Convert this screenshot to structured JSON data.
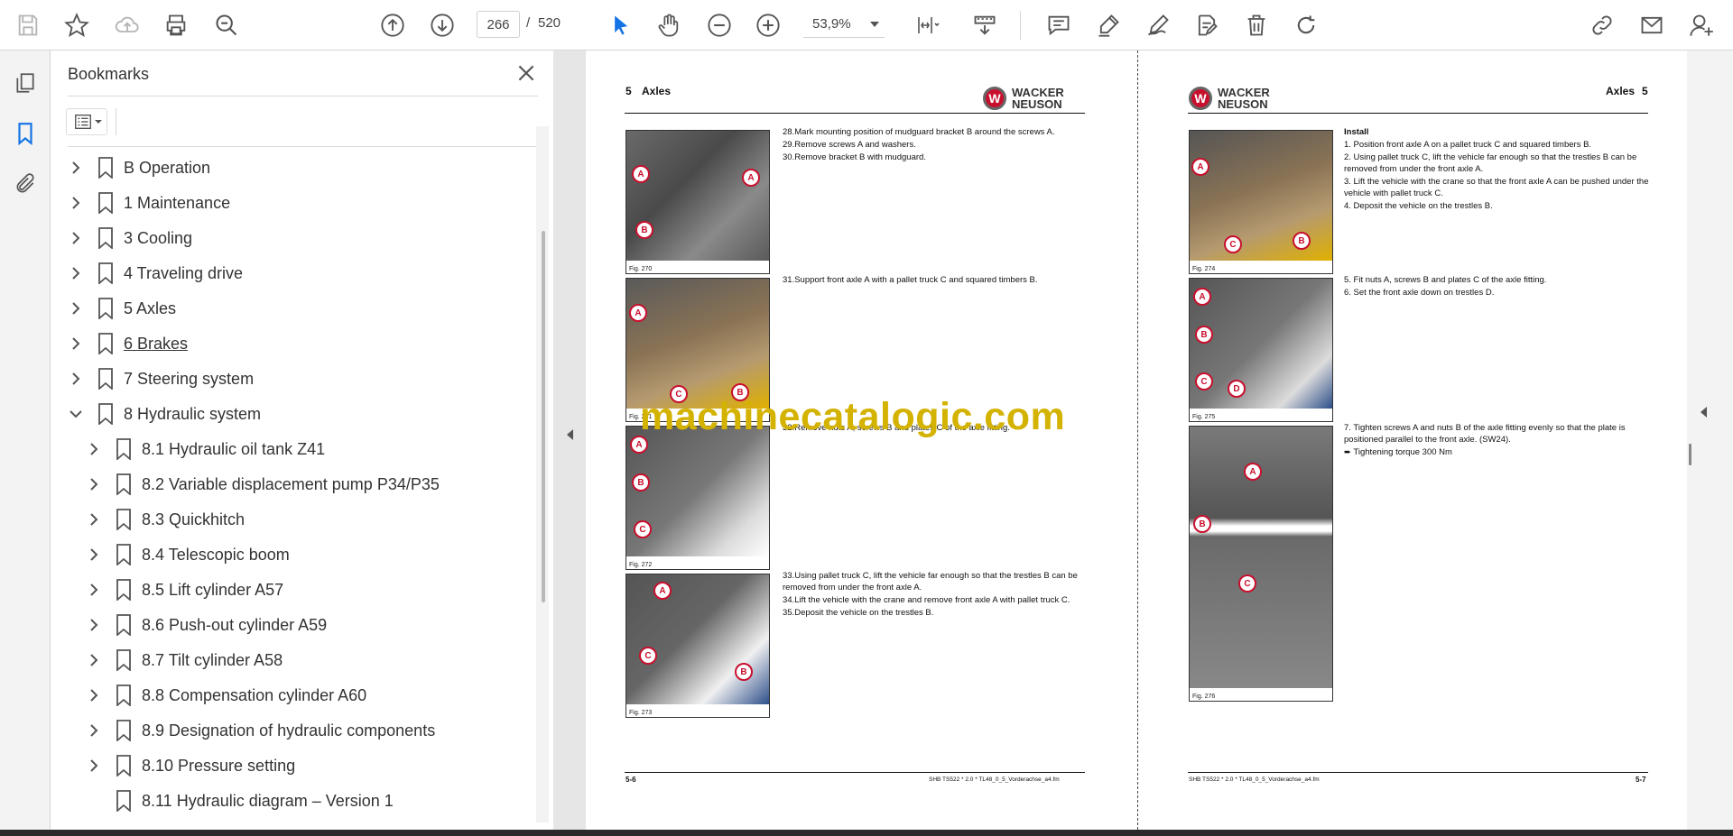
{
  "toolbar": {
    "current_page": "266",
    "page_separator": "/",
    "total_pages": "520",
    "zoom": "53,9%"
  },
  "bookmarks": {
    "title": "Bookmarks",
    "items": [
      {
        "label": "B Operation",
        "level": 0,
        "expanded": false
      },
      {
        "label": "1 Maintenance",
        "level": 0,
        "expanded": false
      },
      {
        "label": "3 Cooling",
        "level": 0,
        "expanded": false
      },
      {
        "label": "4 Traveling drive",
        "level": 0,
        "expanded": false
      },
      {
        "label": "5 Axles",
        "level": 0,
        "expanded": false
      },
      {
        "label": "6 Brakes",
        "level": 0,
        "expanded": false,
        "underlined": true
      },
      {
        "label": "7 Steering system",
        "level": 0,
        "expanded": false
      },
      {
        "label": "8 Hydraulic system",
        "level": 0,
        "expanded": true
      },
      {
        "label": "8.1 Hydraulic oil tank Z41",
        "level": 1,
        "expanded": false
      },
      {
        "label": "8.2 Variable displacement pump P34/P35",
        "level": 1,
        "expanded": false
      },
      {
        "label": "8.3 Quickhitch",
        "level": 1,
        "expanded": false
      },
      {
        "label": "8.4 Telescopic boom",
        "level": 1,
        "expanded": false
      },
      {
        "label": "8.5 Lift cylinder A57",
        "level": 1,
        "expanded": false
      },
      {
        "label": "8.6 Push-out cylinder A59",
        "level": 1,
        "expanded": false
      },
      {
        "label": "8.7 Tilt cylinder A58",
        "level": 1,
        "expanded": false
      },
      {
        "label": "8.8 Compensation cylinder A60",
        "level": 1,
        "expanded": false
      },
      {
        "label": "8.9 Designation of hydraulic components",
        "level": 1,
        "expanded": false
      },
      {
        "label": "8.10 Pressure setting",
        "level": 1,
        "expanded": false
      },
      {
        "label": "8.11 Hydraulic diagram – Version 1",
        "level": 1,
        "leaf": true
      }
    ]
  },
  "left_page": {
    "header_num": "5",
    "header_title": "Axles",
    "brand_line1": "WACKER",
    "brand_line2": "NEUSON",
    "steps_a": [
      "28.Mark mounting position of mudguard bracket B around the screws A.",
      "29.Remove screws A and washers.",
      "30.Remove bracket B with mudguard."
    ],
    "steps_b": [
      "31.Support front axle A with a pallet truck C and squared timbers B."
    ],
    "steps_c": [
      "32.Remove nuts A, screws B and plates C of the axle fitting."
    ],
    "steps_d": [
      "33.Using pallet truck C, lift the vehicle far enough so that the trestles B can be removed from under the front axle A.",
      "34.Lift the vehicle with the crane and remove front axle A with pallet truck C.",
      "35.Deposit the vehicle on the trestles B."
    ],
    "fig_270": "Fig. 270",
    "fig_271": "Fig. 271",
    "fig_272": "Fig. 272",
    "fig_273": "Fig. 273",
    "footer_page": "5-6",
    "footer_doc": "SHB TS522 * 2.0 * TL48_0_5_Vorderachse_a4.fm"
  },
  "right_page": {
    "header_title": "Axles",
    "header_num": "5",
    "brand_line1": "WACKER",
    "brand_line2": "NEUSON",
    "install_title": "Install",
    "steps_a": [
      "1.  Position front axle A on a pallet truck C and squared timbers B.",
      "2.  Using pallet truck C, lift the vehicle far enough so that the trestles B can be removed from under the front axle A.",
      "3.  Lift the vehicle with the crane so that the front axle A can be pushed under the vehicle with pallet truck C.",
      "4.  Deposit the vehicle on the trestles B."
    ],
    "steps_b": [
      "5.  Fit nuts A, screws B and plates C of the axle fitting.",
      "6.  Set the front axle down on trestles D."
    ],
    "steps_c": [
      "7.  Tighten screws A and nuts B of the axle fitting evenly so that the plate is positioned parallel to the front axle. (SW24).",
      "➨  Tightening torque 300 Nm"
    ],
    "fig_274": "Fig. 274",
    "fig_275": "Fig. 275",
    "fig_276": "Fig. 276",
    "footer_page": "5-7",
    "footer_doc": "SHB TS522 * 2.0 * TL48_0_5_Vorderachse_a4.fm"
  },
  "watermark": "machinecatalogic.com",
  "colors": {
    "accent": "#1473e6",
    "marker_red": "#c8102e",
    "watermark": "#d4b200"
  }
}
